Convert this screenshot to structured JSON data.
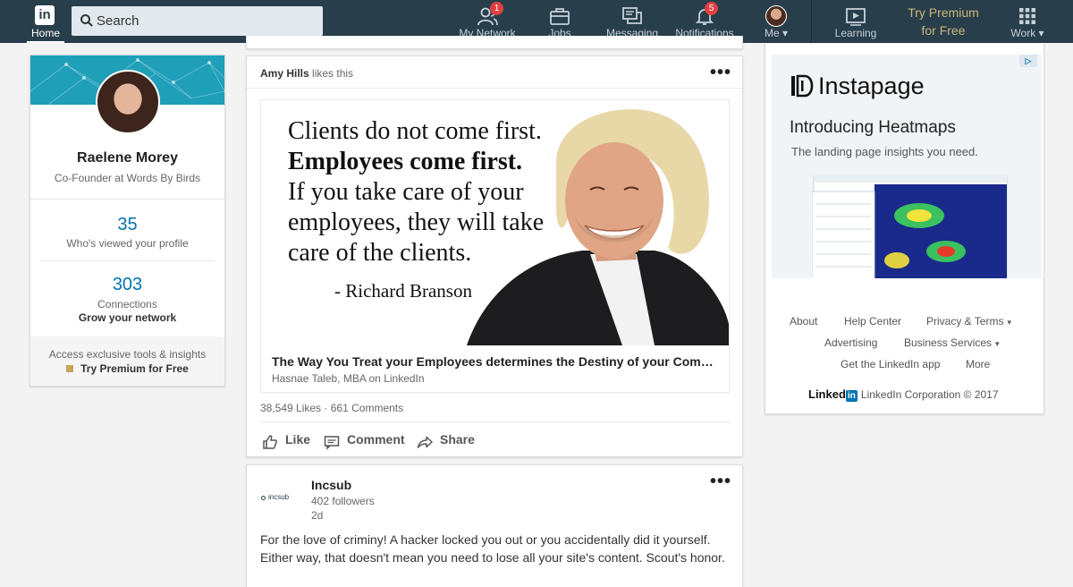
{
  "nav": {
    "home_label": "Home",
    "logo_text": "in",
    "search_placeholder": "Search",
    "items": [
      {
        "label": "My Network",
        "icon": "people-icon",
        "badge": "1"
      },
      {
        "label": "Jobs",
        "icon": "briefcase-icon"
      },
      {
        "label": "Messaging",
        "icon": "chat-icon"
      },
      {
        "label": "Notifications",
        "icon": "bell-icon",
        "badge": "5"
      },
      {
        "label": "Me ▾",
        "icon": "avatar"
      },
      {
        "label": "Learning",
        "icon": "play-video-icon"
      },
      {
        "label": "Work ▾",
        "icon": "grid-icon"
      }
    ],
    "premium_line1": "Try Premium",
    "premium_line2": "for Free",
    "colors": {
      "bar": "#283e4a",
      "premium": "#c9b67a",
      "badge": "#e0403f"
    }
  },
  "profile": {
    "name": "Raelene Morey",
    "headline": "Co-Founder at Words By Birds",
    "views_count": "35",
    "views_label": "Who's viewed your profile",
    "connections_count": "303",
    "connections_label": "Connections",
    "grow_label": "Grow your network",
    "premium_text": "Access exclusive tools & insights",
    "premium_link": "Try Premium for Free"
  },
  "post1": {
    "liker_name": "Amy Hills",
    "liker_action": "likes this",
    "more": "•••",
    "image_quote": {
      "line1": "Clients do not come first.",
      "line2": "Employees come first.",
      "line3": "If you take care of your",
      "line4": "employees, they will take",
      "line5": "care of the clients.",
      "attribution": "- Richard Branson"
    },
    "article_title": "The Way You Treat your Employees determines the Destiny of your Company",
    "article_source": "Hasnae Taleb, MBA on LinkedIn",
    "likes": "38,549 Likes",
    "separator": "·",
    "comments": "661 Comments",
    "actions": {
      "like": "Like",
      "comment": "Comment",
      "share": "Share"
    }
  },
  "post2": {
    "company_name": "Incsub",
    "logo_text": "incsub",
    "followers": "402 followers",
    "age": "2d",
    "more": "•••",
    "text": "For the love of criminy! A hacker locked you out or you accidentally did it yourself. Either way, that doesn't mean you need to lose all your site's content. Scout's honor."
  },
  "ad": {
    "adchoices": "▷",
    "brand": "Instapage",
    "headline": "Introducing Heatmaps",
    "subline": "The landing page insights you need."
  },
  "rail": {
    "about": "About",
    "help_center": "Help Center",
    "privacy_terms": "Privacy & Terms",
    "advertising": "Advertising",
    "business_services": "Business Services",
    "get_app": "Get the LinkedIn app",
    "more": "More",
    "chevron": "▾",
    "footer_word": "Linked",
    "footer_in": "in",
    "copyright": "LinkedIn Corporation © 2017"
  }
}
